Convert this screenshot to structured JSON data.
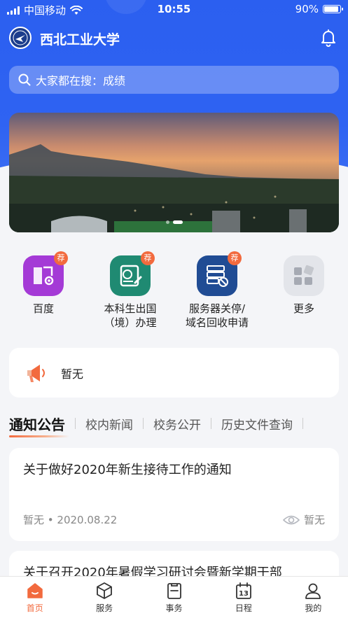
{
  "status_bar": {
    "carrier": "中国移动",
    "time": "10:55",
    "battery": "90%",
    "battery_level": 0.9
  },
  "header": {
    "title": "西北工业大学",
    "logo_icon": "university-seal-icon",
    "notification_icon": "bell-icon"
  },
  "search": {
    "placeholder": "大家都在搜：成绩",
    "icon": "search-icon"
  },
  "banner": {
    "slide_count": 2,
    "active_slide": 2
  },
  "services": [
    {
      "label": "百度",
      "tag": "荐",
      "color": "#a43ad6",
      "icon": "book-settings-icon"
    },
    {
      "label": "本科生出国\n（境）办理",
      "tag": "荐",
      "color": "#1f8a72",
      "icon": "passport-edit-icon"
    },
    {
      "label": "服务器关停/\n域名回收申请",
      "tag": "荐",
      "color": "#204c94",
      "icon": "server-stop-icon"
    },
    {
      "label": "更多",
      "tag": "",
      "color": "#e3e5ea",
      "icon": "grid-more-icon"
    }
  ],
  "notice": {
    "text": "暂无",
    "icon": "megaphone-icon"
  },
  "tabs": [
    {
      "label": "通知公告",
      "active": true
    },
    {
      "label": "校内新闻",
      "active": false
    },
    {
      "label": "校务公开",
      "active": false
    },
    {
      "label": "历史文件查询",
      "active": false
    }
  ],
  "articles": [
    {
      "title": "关于做好2020年新生接待工作的通知",
      "author": "暂无",
      "date": "2020.08.22",
      "views": "暂无"
    },
    {
      "title": "关于召开2020年暑假学习研讨会暨新学期干部",
      "author": "",
      "date": "",
      "views": ""
    }
  ],
  "tabbar": [
    {
      "label": "首页",
      "icon": "home-icon",
      "active": true
    },
    {
      "label": "服务",
      "icon": "cube-icon",
      "active": false
    },
    {
      "label": "事务",
      "icon": "clipboard-icon",
      "active": false
    },
    {
      "label": "日程",
      "icon": "calendar-icon",
      "active": false,
      "day": "13"
    },
    {
      "label": "我的",
      "icon": "user-icon",
      "active": false
    }
  ],
  "colors": {
    "primary": "#2f63f2",
    "accent": "#f26a3e",
    "background": "#f4f5f8"
  }
}
